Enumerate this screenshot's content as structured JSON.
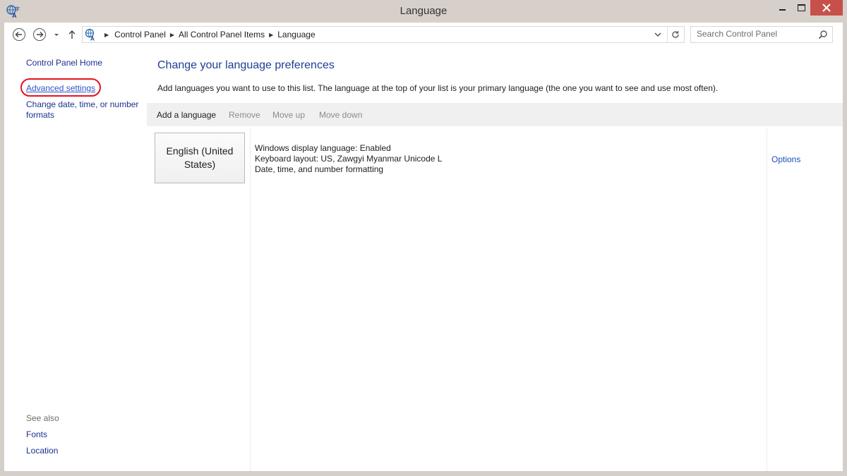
{
  "window": {
    "title": "Language"
  },
  "address": {
    "crumbs": [
      "Control Panel",
      "All Control Panel Items",
      "Language"
    ]
  },
  "search": {
    "placeholder": "Search Control Panel"
  },
  "sidebar": {
    "home": "Control Panel Home",
    "advanced": "Advanced settings",
    "date": "Change date, time, or number formats",
    "see_also": "See also",
    "fonts": "Fonts",
    "location": "Location"
  },
  "main": {
    "heading": "Change your language preferences",
    "description": "Add languages you want to use to this list. The language at the top of your list is your primary language (the one you want to see and use most often).",
    "toolbar": {
      "add": "Add a language",
      "remove": "Remove",
      "move_up": "Move up",
      "move_down": "Move down"
    },
    "language": {
      "name_line1": "English (United",
      "name_line2": "States)",
      "display": "Windows display language: Enabled",
      "keyboard": "Keyboard layout: US, Zawgyi Myanmar Unicode L",
      "formatting": "Date, time, and number formatting",
      "options": "Options"
    }
  },
  "colors": {
    "link": "#1d2f8f",
    "heading": "#1e3f93",
    "highlight": "#e5141b",
    "close": "#c7504a"
  }
}
